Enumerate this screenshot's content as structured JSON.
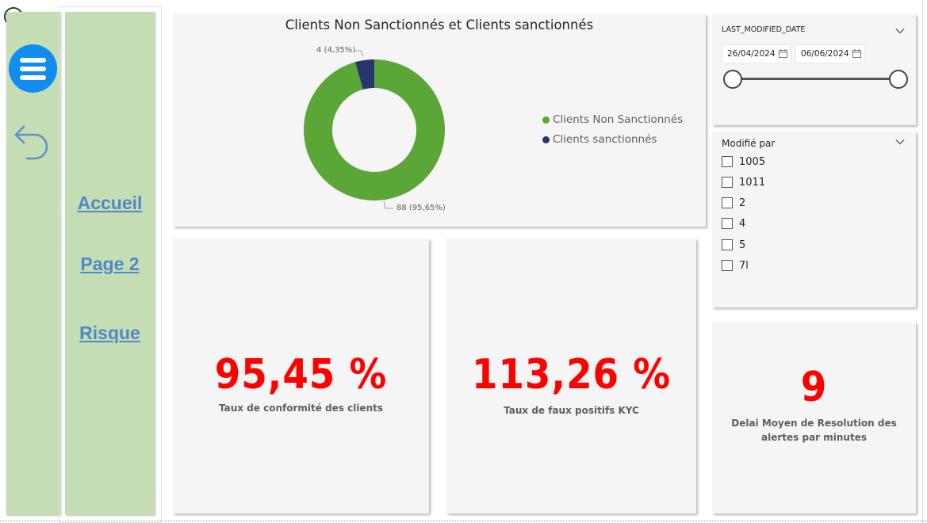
{
  "nav": {
    "links": [
      "Accueil",
      "Page 2",
      "Risque"
    ]
  },
  "donut_card": {
    "title": "Clients Non Sanctionnés et Clients sanctionnés",
    "label_small": "4 (4,35%)",
    "label_large": "88 (95,65%)",
    "legend": [
      {
        "name": "Clients Non Sanctionnés",
        "color": "#5aa637"
      },
      {
        "name": "Clients sanctionnés",
        "color": "#26356b"
      }
    ]
  },
  "chart_data": {
    "type": "pie",
    "title": "Clients Non Sanctionnés et Clients sanctionnés",
    "categories": [
      "Clients Non Sanctionnés",
      "Clients sanctionnés"
    ],
    "values": [
      88,
      4
    ],
    "percentages": [
      95.65,
      4.35
    ],
    "colors": [
      "#5aa637",
      "#26356b"
    ],
    "legend_position": "right",
    "donut": true
  },
  "kpis": [
    {
      "value": "95,45 %",
      "label": "Taux de conformité des clients"
    },
    {
      "value": "113,26 %",
      "label": "Taux de faux positifs KYC"
    },
    {
      "value": "9",
      "label_line1": "Delai Moyen de Resolution des",
      "label_line2": "alertes par minutes"
    }
  ],
  "date_slicer": {
    "title": "LAST_MODIFIED_DATE",
    "start": "26/04/2024",
    "end": "06/06/2024",
    "range_fraction": [
      0,
      1
    ]
  },
  "modifie_slicer": {
    "title": "Modifié par",
    "options": [
      "1005",
      "1011",
      "2",
      "4",
      "5",
      "7l"
    ]
  },
  "colors": {
    "kpi": "#ff0000",
    "nav_bg": "#c4ddb4",
    "link": "#4f89c6",
    "menu_button": "#118df0"
  }
}
